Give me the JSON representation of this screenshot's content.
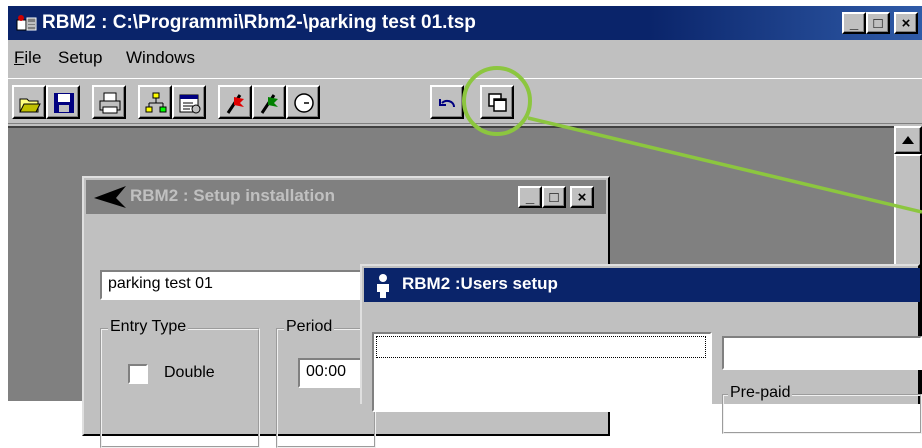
{
  "main_window": {
    "title": "RBM2 : C:\\Programmi\\Rbm2-\\parking test 01.tsp",
    "menu": [
      {
        "key": "F",
        "rest": "ile"
      },
      {
        "key": "",
        "rest": "Setup"
      },
      {
        "key": "",
        "rest": "Windows"
      }
    ],
    "window_buttons": {
      "minimize": "_",
      "maximize": "□",
      "close": "×"
    },
    "toolbar_icons": [
      "open-folder-icon",
      "save-disk-icon",
      "print-icon",
      "network-icon",
      "properties-icon",
      "flag-red-icon",
      "flag-green-icon",
      "clock-icon",
      "undo-icon",
      "cascade-windows-icon"
    ]
  },
  "setup_window": {
    "title": "RBM2 : Setup installation",
    "project_name": "parking test 01",
    "entry_type_label": "Entry Type",
    "double_label": "Double",
    "period_label": "Period",
    "period_value": "00:00"
  },
  "users_window": {
    "title": "RBM2 :Users setup",
    "prepaid_label": "Pre-paid"
  },
  "annotation": {
    "color": "#8cc63f"
  }
}
